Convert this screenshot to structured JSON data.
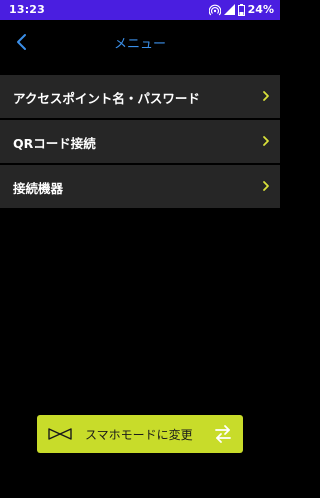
{
  "status_bar": {
    "time": "13:23",
    "battery": "24%"
  },
  "header": {
    "title": "メニュー"
  },
  "menu": {
    "items": [
      {
        "label": "アクセスポイント名・パスワード"
      },
      {
        "label": "QRコード接続"
      },
      {
        "label": "接続機器"
      }
    ]
  },
  "mode_button": {
    "label": "スマホモードに変更"
  },
  "colors": {
    "status_bar": "#4a1ee0",
    "accent_blue": "#3b8fe8",
    "menu_bg": "#262626",
    "chevron": "#d9e23a",
    "mode_button_bg": "#c8dc2a"
  },
  "icons": {
    "status": [
      "hotspot-icon",
      "signal-icon",
      "battery-icon"
    ],
    "header": "back-arrow-icon",
    "menu": "chevron-right-icon",
    "mode_button": [
      "bowtie-icon",
      "swap-arrows-icon"
    ]
  }
}
